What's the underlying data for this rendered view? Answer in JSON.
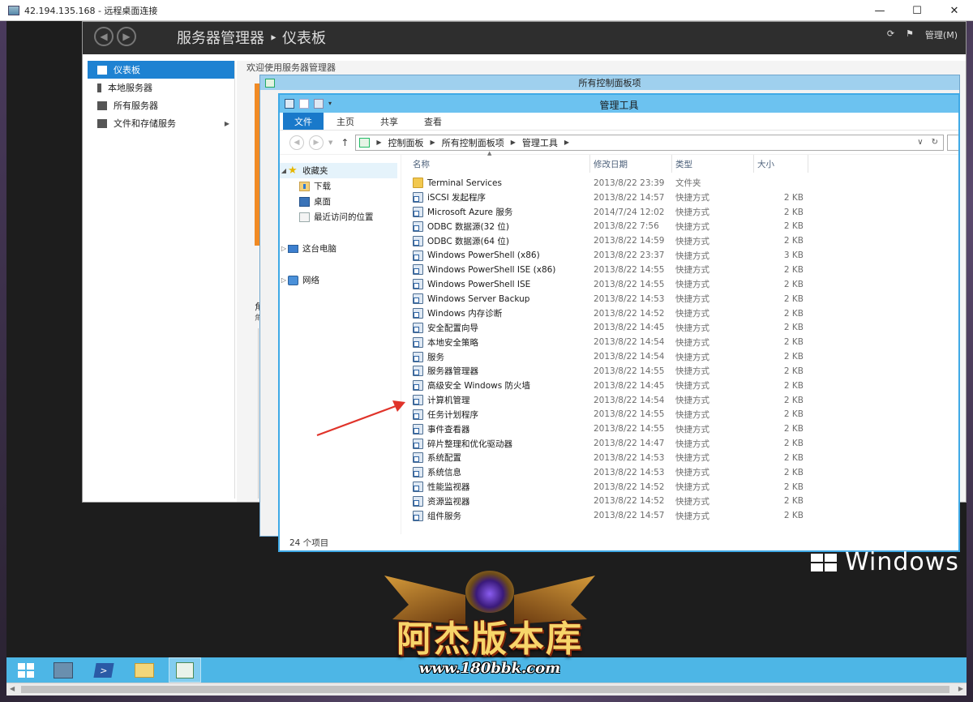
{
  "rdp": {
    "title": "42.194.135.168 - 远程桌面连接",
    "buttons": {
      "minimize": "—",
      "maximize": "☐",
      "close": "✕"
    }
  },
  "server_manager": {
    "title": "服务器管理器 ‣ 仪表板",
    "right_label": "管理(M)",
    "sidebar": [
      {
        "label": "仪表板",
        "active": true
      },
      {
        "label": "本地服务器",
        "active": false
      },
      {
        "label": "所有服务器",
        "active": false
      },
      {
        "label": "文件和存储服务",
        "active": false,
        "has_arrow": true
      }
    ],
    "welcome": "欢迎使用服务器管理器",
    "fragment1": "角",
    "fragment2": "角"
  },
  "control_panel": {
    "title": "所有控制面板项"
  },
  "explorer": {
    "title": "管理工具",
    "ribbon_tabs": [
      "文件",
      "主页",
      "共享",
      "查看"
    ],
    "breadcrumb": [
      "控制面板",
      "所有控制面板项",
      "管理工具"
    ],
    "nav_pane": {
      "favorites": "收藏夹",
      "favorites_items": [
        "下载",
        "桌面",
        "最近访问的位置"
      ],
      "this_pc": "这台电脑",
      "network": "网络"
    },
    "columns": {
      "name": "名称",
      "date": "修改日期",
      "type": "类型",
      "size": "大小"
    },
    "files": [
      {
        "name": "Terminal Services",
        "date": "2013/8/22 23:39",
        "type": "文件夹",
        "size": "",
        "icon": "folder"
      },
      {
        "name": "iSCSI 发起程序",
        "date": "2013/8/22 14:57",
        "type": "快捷方式",
        "size": "2 KB",
        "icon": "shortcut"
      },
      {
        "name": "Microsoft Azure 服务",
        "date": "2014/7/24 12:02",
        "type": "快捷方式",
        "size": "2 KB",
        "icon": "shortcut"
      },
      {
        "name": "ODBC 数据源(32 位)",
        "date": "2013/8/22 7:56",
        "type": "快捷方式",
        "size": "2 KB",
        "icon": "shortcut"
      },
      {
        "name": "ODBC 数据源(64 位)",
        "date": "2013/8/22 14:59",
        "type": "快捷方式",
        "size": "2 KB",
        "icon": "shortcut"
      },
      {
        "name": "Windows PowerShell (x86)",
        "date": "2013/8/22 23:37",
        "type": "快捷方式",
        "size": "3 KB",
        "icon": "shortcut"
      },
      {
        "name": "Windows PowerShell ISE (x86)",
        "date": "2013/8/22 14:55",
        "type": "快捷方式",
        "size": "2 KB",
        "icon": "shortcut"
      },
      {
        "name": "Windows PowerShell ISE",
        "date": "2013/8/22 14:55",
        "type": "快捷方式",
        "size": "2 KB",
        "icon": "shortcut"
      },
      {
        "name": "Windows Server Backup",
        "date": "2013/8/22 14:53",
        "type": "快捷方式",
        "size": "2 KB",
        "icon": "shortcut"
      },
      {
        "name": "Windows 内存诊断",
        "date": "2013/8/22 14:52",
        "type": "快捷方式",
        "size": "2 KB",
        "icon": "shortcut"
      },
      {
        "name": "安全配置向导",
        "date": "2013/8/22 14:45",
        "type": "快捷方式",
        "size": "2 KB",
        "icon": "shortcut"
      },
      {
        "name": "本地安全策略",
        "date": "2013/8/22 14:54",
        "type": "快捷方式",
        "size": "2 KB",
        "icon": "shortcut"
      },
      {
        "name": "服务",
        "date": "2013/8/22 14:54",
        "type": "快捷方式",
        "size": "2 KB",
        "icon": "shortcut"
      },
      {
        "name": "服务器管理器",
        "date": "2013/8/22 14:55",
        "type": "快捷方式",
        "size": "2 KB",
        "icon": "shortcut"
      },
      {
        "name": "高级安全 Windows 防火墙",
        "date": "2013/8/22 14:45",
        "type": "快捷方式",
        "size": "2 KB",
        "icon": "shortcut"
      },
      {
        "name": "计算机管理",
        "date": "2013/8/22 14:54",
        "type": "快捷方式",
        "size": "2 KB",
        "icon": "shortcut"
      },
      {
        "name": "任务计划程序",
        "date": "2013/8/22 14:55",
        "type": "快捷方式",
        "size": "2 KB",
        "icon": "shortcut"
      },
      {
        "name": "事件查看器",
        "date": "2013/8/22 14:55",
        "type": "快捷方式",
        "size": "2 KB",
        "icon": "shortcut"
      },
      {
        "name": "碎片整理和优化驱动器",
        "date": "2013/8/22 14:47",
        "type": "快捷方式",
        "size": "2 KB",
        "icon": "shortcut"
      },
      {
        "name": "系统配置",
        "date": "2013/8/22 14:53",
        "type": "快捷方式",
        "size": "2 KB",
        "icon": "shortcut"
      },
      {
        "name": "系统信息",
        "date": "2013/8/22 14:53",
        "type": "快捷方式",
        "size": "2 KB",
        "icon": "shortcut"
      },
      {
        "name": "性能监视器",
        "date": "2013/8/22 14:52",
        "type": "快捷方式",
        "size": "2 KB",
        "icon": "shortcut"
      },
      {
        "name": "资源监视器",
        "date": "2013/8/22 14:52",
        "type": "快捷方式",
        "size": "2 KB",
        "icon": "shortcut"
      },
      {
        "name": "组件服务",
        "date": "2013/8/22 14:57",
        "type": "快捷方式",
        "size": "2 KB",
        "icon": "shortcut"
      }
    ],
    "status": "24 个项目"
  },
  "desktop": {
    "windows_word": "Windows"
  },
  "watermark": {
    "main": "阿杰版本库",
    "url": "www.180bbk.com"
  },
  "annotation": {
    "arrow_color": "#e0332a"
  }
}
